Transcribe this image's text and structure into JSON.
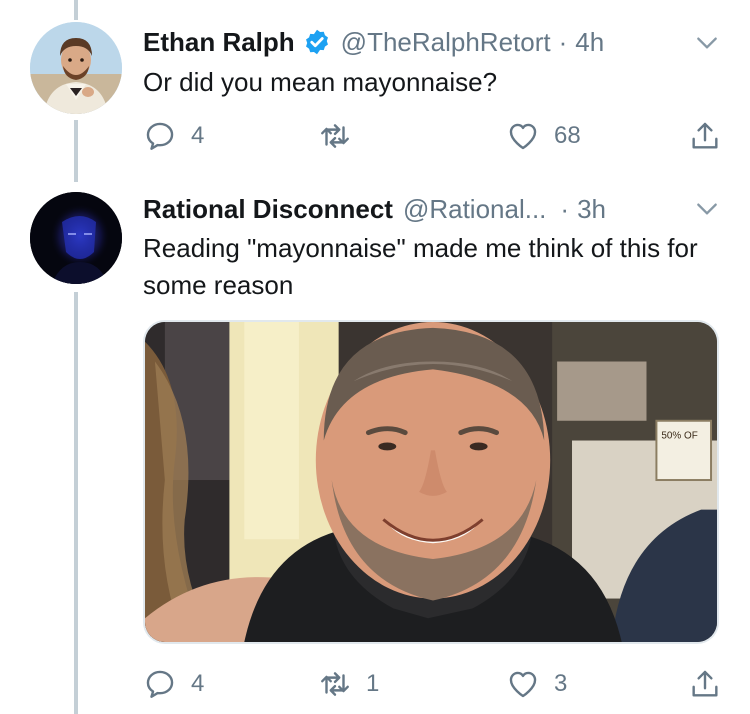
{
  "tweets": [
    {
      "name": "Ethan Ralph",
      "verified": true,
      "handle": "@TheRalphRetort",
      "separator": "·",
      "time": "4h",
      "text": "Or did you mean mayonnaise?",
      "actions": {
        "replies": "4",
        "retweets": "",
        "likes": "68"
      }
    },
    {
      "name": "Rational Disconnect",
      "verified": false,
      "handle": "@Rational...",
      "separator": "·",
      "time": "3h",
      "text": "Reading \"mayonnaise\" made me think of this for some reason",
      "media": {
        "sign_text": "50% OF"
      },
      "actions": {
        "replies": "4",
        "retweets": "1",
        "likes": "3"
      }
    }
  ],
  "colors": {
    "text": "#14171a",
    "secondary": "#657786",
    "verified_blue": "#1da1f2",
    "thread_line": "#c4cfd6"
  },
  "icons": {
    "reply": "reply-icon",
    "retweet": "retweet-icon",
    "like": "heart-icon",
    "share": "share-icon",
    "more": "chevron-down-icon",
    "verified": "verified-badge-icon"
  }
}
